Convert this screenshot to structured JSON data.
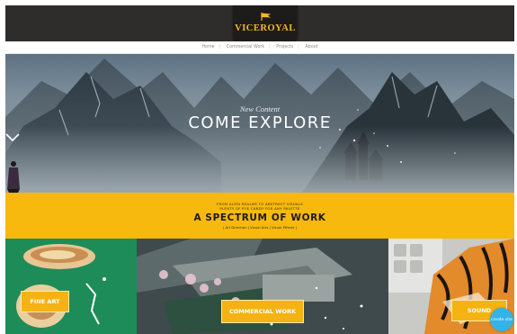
{
  "header": {
    "logo_text": "VICEROYAL",
    "logo_icon": "flag-icon"
  },
  "nav": {
    "items": [
      "Home",
      "Commercial Work",
      "Projects",
      "About"
    ]
  },
  "hero": {
    "subtitle": "New Content",
    "title": "COME EXPLORE",
    "scroll_icon": "chevron-down-icon"
  },
  "band": {
    "line1": "FROM ALIEN REALMS TO ABSTRACT VISUALS",
    "line2": "PLENTY OF EYE CANDY FOR ANY PALETTE",
    "title": "A SPECTRUM OF WORK",
    "tags": "| Art Direction | Visual Arts | Visual Effects |"
  },
  "tiles": [
    {
      "label": "FINE ART"
    },
    {
      "label": "COMMERCIAL WORK"
    },
    {
      "label": "SOUND"
    }
  ],
  "chat": {
    "label": "create site"
  },
  "colors": {
    "accent": "#f7b90e",
    "header_bg": "#2f2d2b",
    "logo_gold": "#f1b928"
  }
}
